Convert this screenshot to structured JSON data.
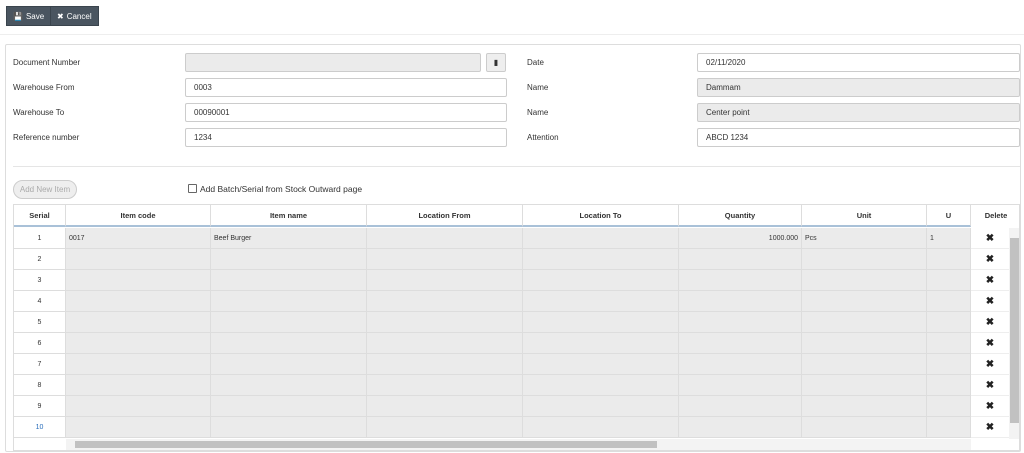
{
  "toolbar": {
    "save_label": "Save",
    "cancel_label": "Cancel"
  },
  "form": {
    "document_number_label": "Document Number",
    "document_number": "",
    "warehouse_from_label": "Warehouse From",
    "warehouse_from": "0003",
    "warehouse_to_label": "Warehouse To",
    "warehouse_to": "00090001",
    "reference_label": "Reference number",
    "reference": "1234",
    "date_label": "Date",
    "date": "02/11/2020",
    "name_from_label": "Name",
    "name_from": "Dammam",
    "name_to_label": "Name",
    "name_to": "Center point",
    "attention_label": "Attention",
    "attention": "ABCD 1234"
  },
  "add_item_label": "Add New Item",
  "batch_checkbox_label": "Add Batch/Serial from Stock Outward page",
  "table": {
    "headers": [
      "Serial",
      "Item code",
      "Item name",
      "Location From",
      "Location To",
      "Quantity",
      "Unit",
      "U",
      "Delete"
    ],
    "rows": [
      {
        "serial": "1",
        "item_code": "0017",
        "item_name": "Beef Burger",
        "location_from": "",
        "location_to": "",
        "quantity": "1000.000",
        "unit": "Pcs",
        "u": "1"
      },
      {
        "serial": "2"
      },
      {
        "serial": "3"
      },
      {
        "serial": "4"
      },
      {
        "serial": "5"
      },
      {
        "serial": "6"
      },
      {
        "serial": "7"
      },
      {
        "serial": "8"
      },
      {
        "serial": "9"
      },
      {
        "serial": "10"
      }
    ]
  }
}
